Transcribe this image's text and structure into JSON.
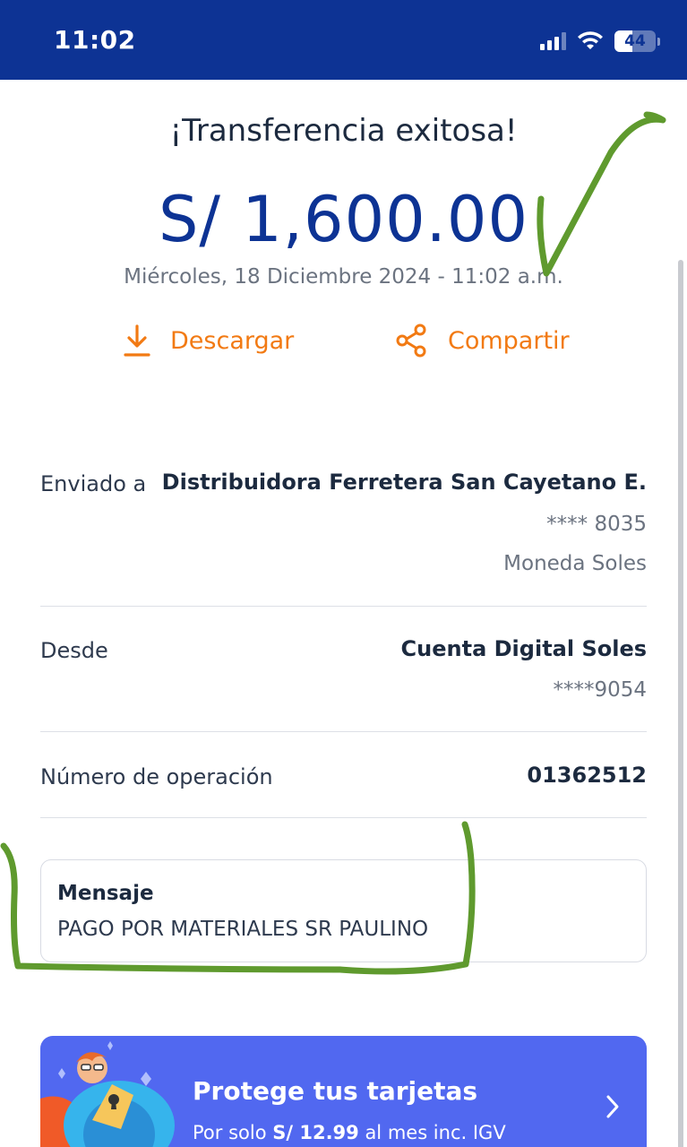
{
  "status_bar": {
    "time": "11:02",
    "battery": "44",
    "battery_level": 0.44
  },
  "receipt": {
    "title": "¡Transferencia exitosa!",
    "amount": "S/ 1,600.00",
    "date": "Miércoles, 18 Diciembre 2024 - 11:02 a.m."
  },
  "actions": {
    "download_label": "Descargar",
    "share_label": "Compartir"
  },
  "details": {
    "sent_to": {
      "label": "Enviado a",
      "name": "Distribuidora Ferretera San Cayetano E.",
      "account": "**** 8035",
      "currency": "Moneda Soles"
    },
    "from": {
      "label": "Desde",
      "account_name": "Cuenta Digital Soles",
      "account_number": "****9054"
    },
    "operation": {
      "label": "Número de operación",
      "number": "01362512"
    }
  },
  "message": {
    "title": "Mensaje",
    "text": "PAGO POR MATERIALES SR PAULINO"
  },
  "promo": {
    "title": "Protege tus tarjetas",
    "sub_prefix": "Por solo ",
    "sub_price": "S/ 12.99",
    "sub_suffix": " al mes inc. IGV"
  },
  "colors": {
    "brand_blue": "#0d3394",
    "accent_orange": "#f27a13",
    "promo_blue": "#5168f0",
    "annotation_green": "#5f9a2e"
  },
  "icons": [
    "signal-icon",
    "wifi-icon",
    "battery-icon",
    "download-icon",
    "share-icon",
    "chevron-right-icon",
    "mascot-illustration"
  ]
}
